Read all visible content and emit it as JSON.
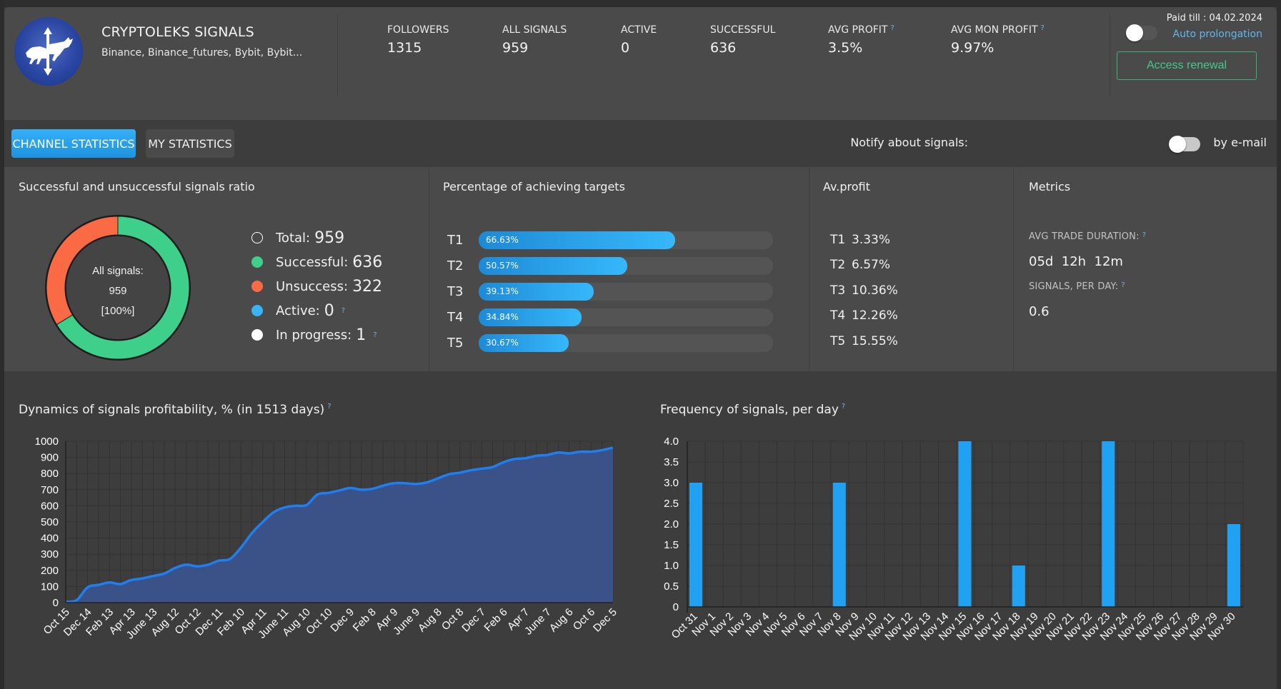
{
  "header": {
    "logo_icon": "bull-bear-arrows-logo",
    "title": "CRYPTOLEKS SIGNALS",
    "exchanges": "Binance, Binance_futures, Bybit, Bybit...",
    "stats": [
      {
        "label": "FOLLOWERS",
        "value": "1315",
        "help": false
      },
      {
        "label": "ALL SIGNALS",
        "value": "959",
        "help": false
      },
      {
        "label": "ACTIVE",
        "value": "0",
        "help": false
      },
      {
        "label": "SUCCESSFUL",
        "value": "636",
        "help": false
      },
      {
        "label": "AVG PROFIT",
        "value": "3.5%",
        "help": true
      },
      {
        "label": "AVG MON PROFIT",
        "value": "9.97%",
        "help": true
      }
    ],
    "help_mark": "?",
    "paid_till": "Paid till : 04.02.2024",
    "auto_prolongation": "Auto prolongation",
    "auto_prolongation_on": false,
    "access_renewal": "Access renewal"
  },
  "tabs": {
    "channel_statistics": "CHANNEL STATISTICS",
    "my_statistics": "MY STATISTICS",
    "active": "channel_statistics"
  },
  "notify": {
    "label": "Notify about signals:",
    "by_email": "by e-mail",
    "enabled": false
  },
  "ratio_panel": {
    "title": "Successful and unsuccessful signals ratio",
    "center_label": "All signals:",
    "center_value": "959",
    "center_pct": "[100%]",
    "legend": [
      {
        "label": "Total:",
        "value": "959",
        "color": "#ffffff",
        "hollow": true,
        "help": false
      },
      {
        "label": "Successful:",
        "value": "636",
        "color": "#3ecf8a",
        "hollow": false,
        "help": false
      },
      {
        "label": "Unsuccess:",
        "value": "322",
        "color": "#fa6a45",
        "hollow": false,
        "help": false
      },
      {
        "label": "Active:",
        "value": "0",
        "color": "#38b4f4",
        "hollow": false,
        "help": true
      },
      {
        "label": "In progress:",
        "value": "1",
        "color": "#ffffff",
        "hollow": false,
        "help": true
      }
    ],
    "donut": {
      "successful": 636,
      "unsuccess": 322,
      "successful_color": "#3ecf8a",
      "unsuccess_color": "#fa6a45"
    }
  },
  "targets_panel": {
    "title": "Percentage of achieving targets",
    "targets": [
      {
        "label": "T1",
        "pct": 66.63,
        "text": "66.63%"
      },
      {
        "label": "T2",
        "pct": 50.57,
        "text": "50.57%"
      },
      {
        "label": "T3",
        "pct": 39.13,
        "text": "39.13%"
      },
      {
        "label": "T4",
        "pct": 34.84,
        "text": "34.84%"
      },
      {
        "label": "T5",
        "pct": 30.67,
        "text": "30.67%"
      }
    ]
  },
  "avprofit_panel": {
    "title": "Av.profit",
    "rows": [
      {
        "label": "T1",
        "value": "3.33%"
      },
      {
        "label": "T2",
        "value": "6.57%"
      },
      {
        "label": "T3",
        "value": "10.36%"
      },
      {
        "label": "T4",
        "value": "12.26%"
      },
      {
        "label": "T5",
        "value": "15.55%"
      }
    ]
  },
  "metrics_panel": {
    "title": "Metrics",
    "avg_trade_duration_label": "AVG TRADE DURATION:",
    "avg_trade_duration": "05d  12h  12m",
    "signals_per_day_label": "SIGNALS, PER DAY:",
    "signals_per_day": "0.6"
  },
  "chart_data": [
    {
      "type": "area",
      "title": "Dynamics of signals profitability, % (in 1513 days)",
      "xlabel": "",
      "ylabel": "",
      "ylim": [
        0,
        1000
      ],
      "yticks": [
        0,
        100,
        200,
        300,
        400,
        500,
        600,
        700,
        800,
        900,
        1000
      ],
      "grid": true,
      "legend": "none",
      "categories": [
        "Oct 15",
        "Dec 14",
        "Feb 13",
        "Apr 13",
        "June 13",
        "Aug 12",
        "Oct 12",
        "Dec 11",
        "Feb 10",
        "Apr 11",
        "June 11",
        "Aug 10",
        "Oct 10",
        "Dec 9",
        "Feb 8",
        "Apr 9",
        "June 9",
        "Aug 8",
        "Oct 8",
        "Dec 7",
        "Feb 6",
        "Apr 7",
        "June 7",
        "Aug 6",
        "Oct 6",
        "Dec 5"
      ],
      "x": [
        0,
        0.5,
        1,
        1.5,
        2,
        2.5,
        3,
        3.5,
        4,
        4.5,
        5,
        5.5,
        6,
        6.5,
        7,
        7.5,
        8,
        8.5,
        9,
        9.5,
        10,
        10.5,
        11,
        11.5,
        12,
        12.5,
        13,
        13.5,
        14,
        14.5,
        15,
        15.5,
        16,
        16.5,
        17,
        17.5,
        18,
        18.5,
        19,
        19.5,
        20,
        20.5,
        21,
        21.5,
        22,
        22.5,
        23,
        23.5,
        24,
        24.5,
        25
      ],
      "values": [
        5,
        15,
        95,
        110,
        125,
        115,
        140,
        150,
        165,
        180,
        215,
        235,
        225,
        235,
        260,
        270,
        340,
        430,
        500,
        560,
        590,
        600,
        605,
        670,
        680,
        695,
        710,
        700,
        705,
        725,
        740,
        740,
        735,
        745,
        770,
        795,
        805,
        820,
        830,
        840,
        870,
        890,
        895,
        910,
        915,
        930,
        925,
        935,
        935,
        945,
        960
      ]
    },
    {
      "type": "bar",
      "title": "Frequency of signals, per day",
      "xlabel": "",
      "ylabel": "",
      "ylim": [
        0,
        4.0
      ],
      "yticks": [
        0,
        0.5,
        1.0,
        1.5,
        2.0,
        2.5,
        3.0,
        3.5,
        4.0
      ],
      "grid": true,
      "legend": "none",
      "categories": [
        "Oct 31",
        "Nov 1",
        "Nov 2",
        "Nov 3",
        "Nov 4",
        "Nov 5",
        "Nov 6",
        "Nov 7",
        "Nov 8",
        "Nov 9",
        "Nov 10",
        "Nov 11",
        "Nov 12",
        "Nov 13",
        "Nov 14",
        "Nov 15",
        "Nov 16",
        "Nov 17",
        "Nov 18",
        "Nov 19",
        "Nov 20",
        "Nov 21",
        "Nov 22",
        "Nov 23",
        "Nov 24",
        "Nov 25",
        "Nov 26",
        "Nov 27",
        "Nov 28",
        "Nov 29",
        "Nov 30"
      ],
      "values": [
        3,
        0,
        0,
        0,
        0,
        0,
        0,
        0,
        3,
        0,
        0,
        0,
        0,
        0,
        0,
        4,
        0,
        0,
        1,
        0,
        0,
        0,
        0,
        4,
        0,
        0,
        0,
        0,
        0,
        0,
        2
      ],
      "color": "#21a1f1"
    }
  ]
}
